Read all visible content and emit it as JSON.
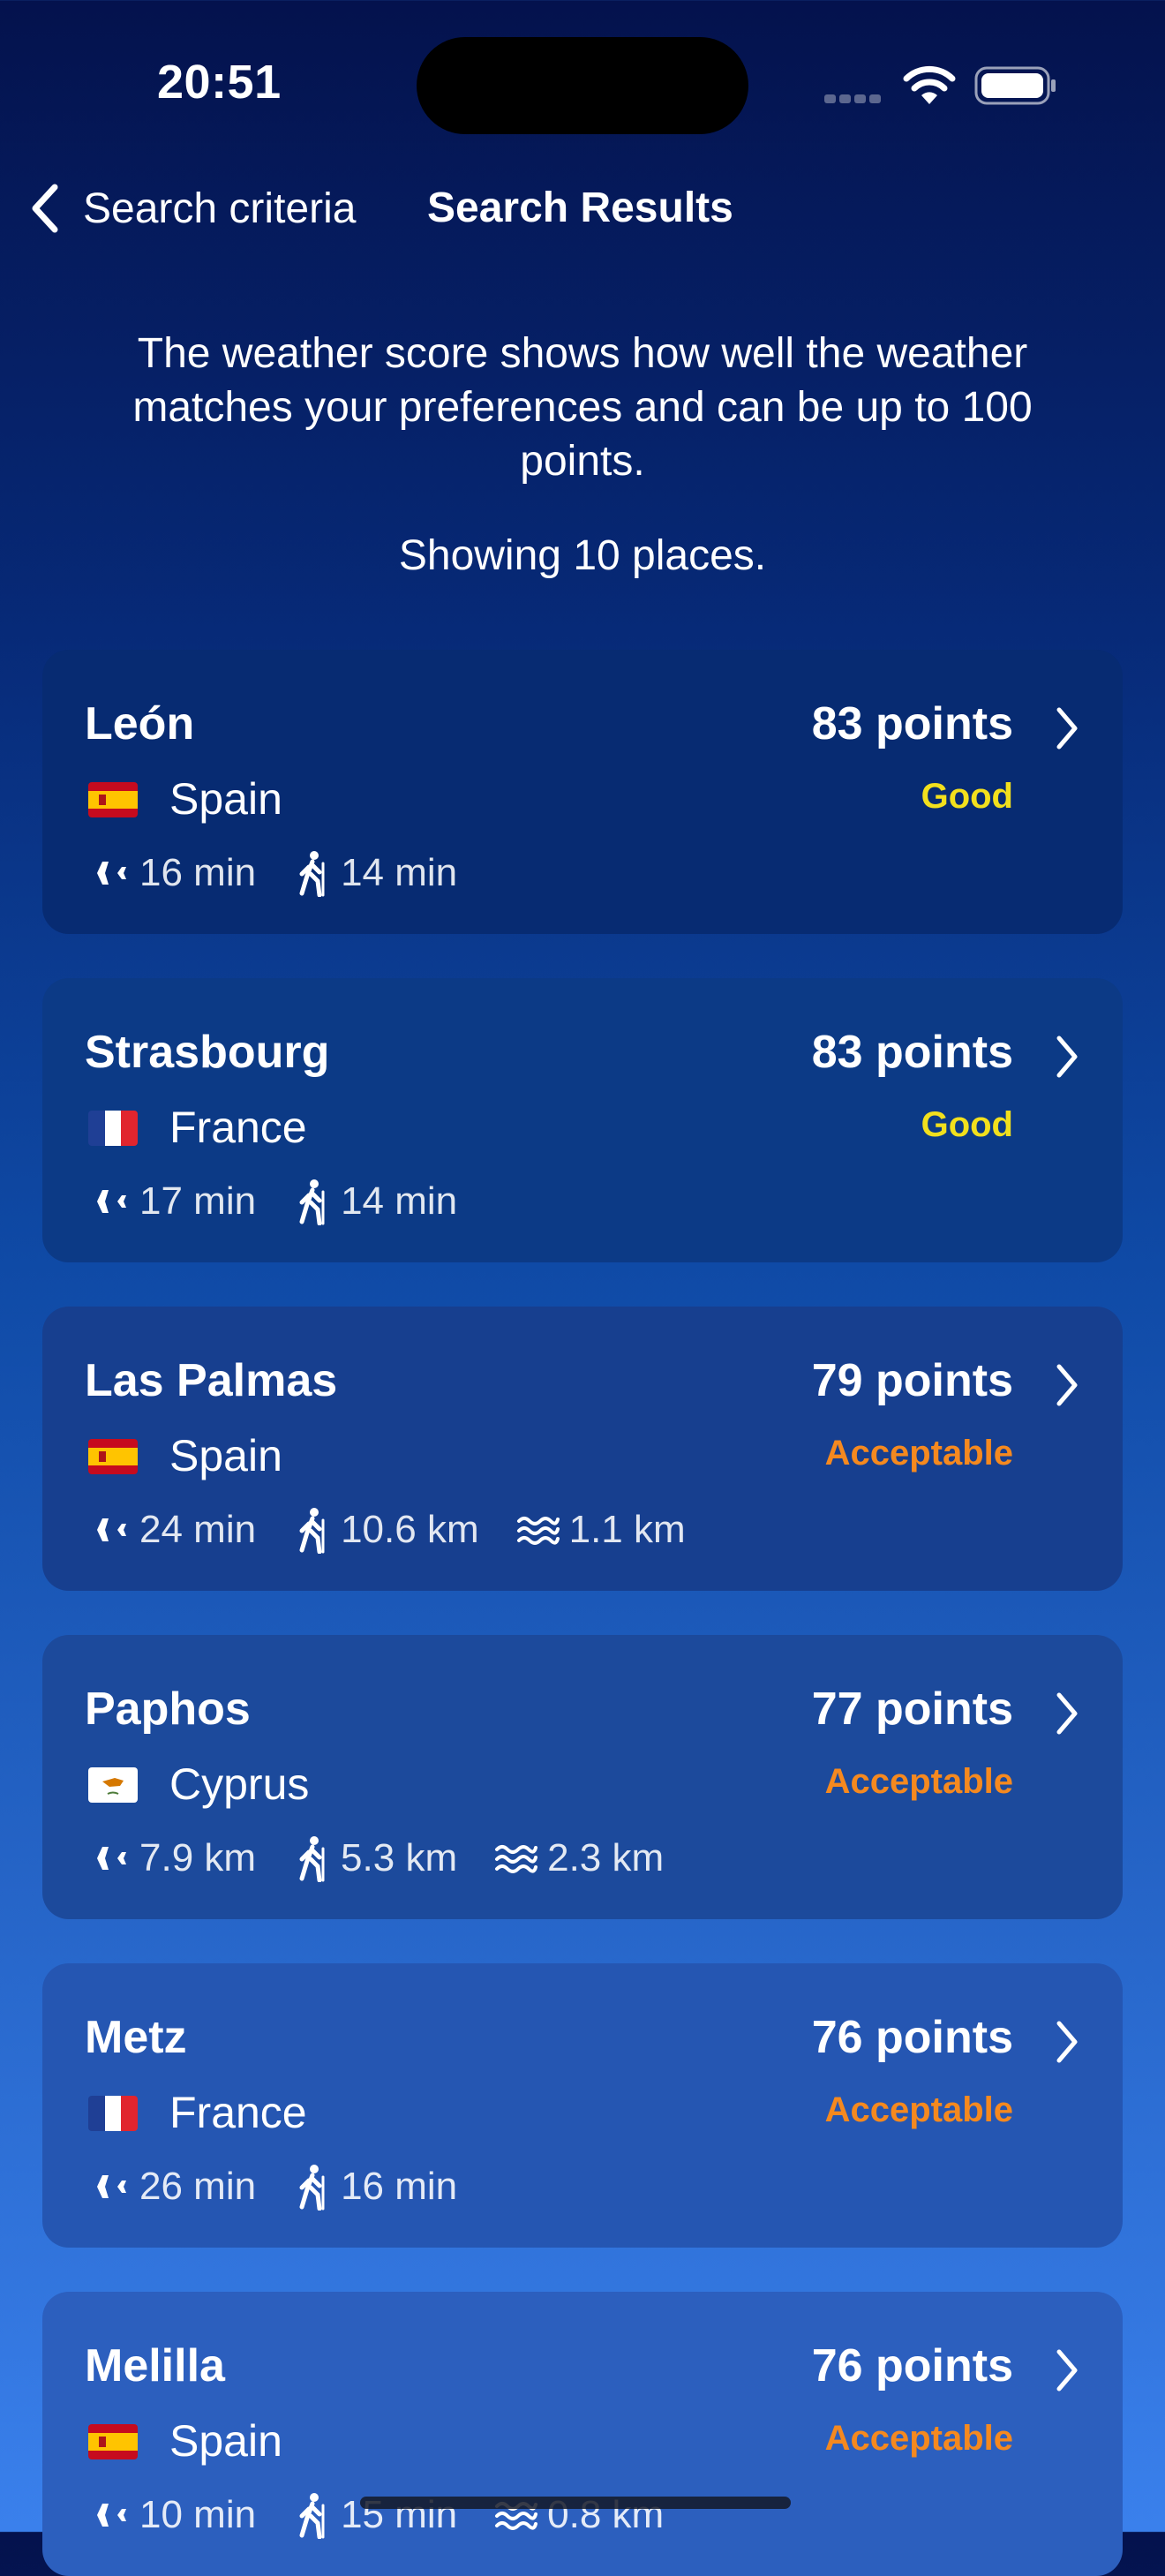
{
  "status_bar": {
    "time": "20:51"
  },
  "nav": {
    "back_label": "Search criteria",
    "title": "Search Results"
  },
  "intro": {
    "description": "The weather score shows how well the weather matches your preferences and can be up to 100 points.",
    "count": "Showing 10 places."
  },
  "colors": {
    "good": "#f2e01d",
    "acceptable": "#f5891f"
  },
  "results": [
    {
      "name": "León",
      "country": "Spain",
      "flag": "spain-flag",
      "points": "83 points",
      "rating": "Good",
      "flight": "16 min",
      "hike": "14 min",
      "beach": ""
    },
    {
      "name": "Strasbourg",
      "country": "France",
      "flag": "france-flag",
      "points": "83 points",
      "rating": "Good",
      "flight": "17 min",
      "hike": "14 min",
      "beach": ""
    },
    {
      "name": "Las Palmas",
      "country": "Spain",
      "flag": "spain-flag",
      "points": "79 points",
      "rating": "Acceptable",
      "flight": "24 min",
      "hike": "10.6 km",
      "beach": "1.1 km"
    },
    {
      "name": "Paphos",
      "country": "Cyprus",
      "flag": "cyprus-flag",
      "points": "77 points",
      "rating": "Acceptable",
      "flight": "7.9 km",
      "hike": "5.3 km",
      "beach": "2.3 km"
    },
    {
      "name": "Metz",
      "country": "France",
      "flag": "france-flag",
      "points": "76 points",
      "rating": "Acceptable",
      "flight": "26 min",
      "hike": "16 min",
      "beach": ""
    },
    {
      "name": "Melilla",
      "country": "Spain",
      "flag": "spain-flag",
      "points": "76 points",
      "rating": "Acceptable",
      "flight": "10 min",
      "hike": "15 min",
      "beach": "0.8 km"
    }
  ]
}
